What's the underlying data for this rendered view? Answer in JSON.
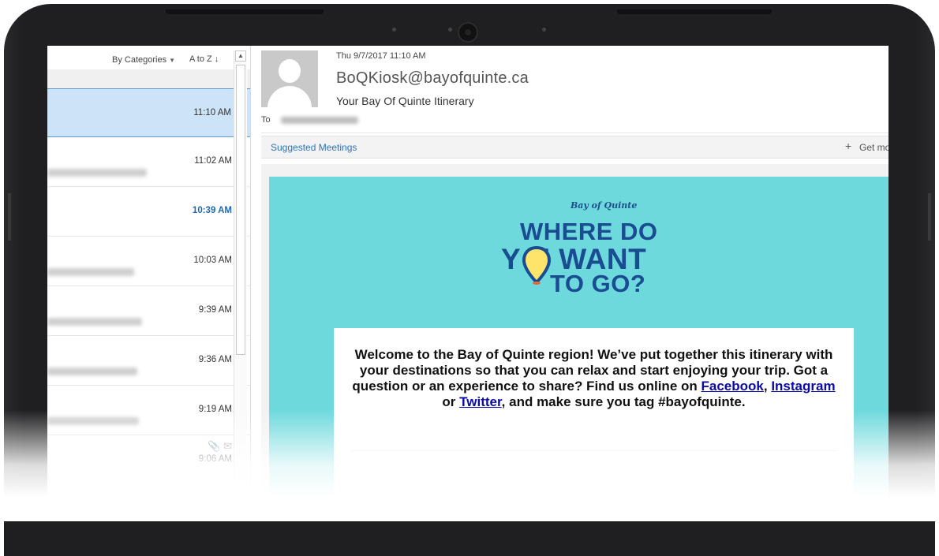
{
  "list": {
    "sort_by": "By Categories",
    "sort_order": "A to Z",
    "messages": [
      {
        "time": "11:10 AM",
        "selected": true
      },
      {
        "time": "11:02 AM"
      },
      {
        "time": "10:39 AM",
        "unread": true
      },
      {
        "time": "10:03 AM"
      },
      {
        "time": "9:39 AM"
      },
      {
        "time": "9:36 AM"
      },
      {
        "time": "9:19 AM"
      },
      {
        "time": "9:06 AM"
      }
    ]
  },
  "message": {
    "date": "Thu 9/7/2017 11:10 AM",
    "sender": "BoQKiosk@bayofquinte.ca",
    "subject": "Your Bay Of Quinte Itinerary",
    "to_label": "To"
  },
  "suggested_meetings": {
    "label": "Suggested Meetings",
    "get_more": "Get mo"
  },
  "email": {
    "logo": "Bay of Quinte",
    "hero_line1": "WHERE DO",
    "hero_line2": "Y  U WANT",
    "hero_line3": "TO GO?",
    "welcome_prefix": "Welcome to the Bay of Quinte region! We’ve put together this itinerary with your destinations so that you can relax and start enjoying your trip. Got a question or an experience to share? Find us online on ",
    "link_facebook": "Facebook",
    "link_instagram": "Instagram",
    "link_twitter": "Twitter",
    "welcome_sep1": ", ",
    "welcome_sep2": " or ",
    "welcome_suffix": ", and make sure you tag #bayofquinte."
  },
  "colors": {
    "accent_blue": "#2e75b6",
    "selected_row": "#cde3f7",
    "teal": "#6ed9dd",
    "hero_text": "#1a4c91"
  }
}
